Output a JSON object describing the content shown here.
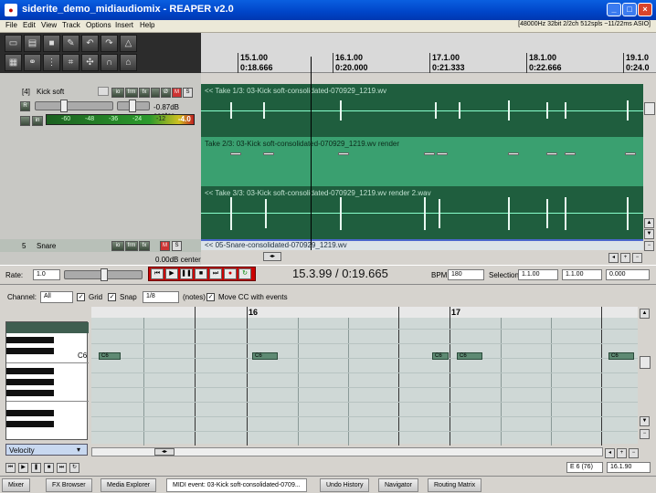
{
  "window": {
    "title": "siderite_demo_midiaudiomix - REAPER v2.0",
    "controls": [
      "_",
      "□",
      "×"
    ]
  },
  "menu": {
    "items": [
      "File",
      "Edit",
      "View",
      "Track",
      "Options",
      "Insert",
      "Help"
    ],
    "status": "[48000Hz 32bit 2/2ch 512spls ~11/22ms ASIO]"
  },
  "ruler": {
    "bars": [
      {
        "bar": "15.1.00",
        "time": "0:18.666"
      },
      {
        "bar": "16.1.00",
        "time": "0:20.000"
      },
      {
        "bar": "17.1.00",
        "time": "0:21.333"
      },
      {
        "bar": "18.1.00",
        "time": "0:22.666"
      },
      {
        "bar": "19.1.0",
        "time": "0:24.0"
      }
    ]
  },
  "track4": {
    "num": "[4]",
    "name": "Kick soft",
    "vol": "-0.87dB center",
    "peak": "-4.0",
    "meter_ticks": [
      "-60",
      "-48",
      "-36",
      "-24",
      "-12"
    ],
    "btn_io": "io",
    "btn_fx": "fx",
    "btn_m": "M",
    "btn_s": "S",
    "btn_frm": "frm",
    "btn_r": "R",
    "btn_in": "in"
  },
  "lanes": {
    "take1": "<< Take 1/3: 03-Kick soft-consolidated-070929_1219.wv",
    "take2": "Take 2/3: 03-Kick soft-consolidated-070929_1219.wv render",
    "take3": "<< Take 3/3: 03-Kick soft-consolidated-070929_1219.wv render 2.wav"
  },
  "track5": {
    "num": "5",
    "name": "Snare",
    "vol": "0.00dB center",
    "item": "<< 05-Snare-consolidated-070929_1219.wv"
  },
  "transport": {
    "rate_label": "Rate:",
    "rate": "1.0",
    "timecode": "15.3.99 / 0:19.665",
    "bpm_label": "BPM:",
    "bpm": "180",
    "sel_label": "Selection:",
    "sel_start": "1.1.00",
    "sel_end": "1.1.00",
    "sel_len": "0.000"
  },
  "midi": {
    "channel_label": "Channel:",
    "channel": "All",
    "grid": "Grid",
    "snap": "Snap",
    "div": "1/8",
    "notes": "(notes)",
    "movecc": "Move CC with events",
    "bar16": "16",
    "bar17": "17",
    "key_label": "C6",
    "note_label": "C6",
    "velocity": "Velocity",
    "status_note": "E 6 (76)",
    "status_pos": "16.1.90"
  },
  "tabs": [
    "Mixer",
    "FX Browser",
    "Media Explorer",
    "MIDI event: 03-Kick soft-consolidated-0709...",
    "Undo History",
    "Navigator",
    "Routing Matrix"
  ]
}
